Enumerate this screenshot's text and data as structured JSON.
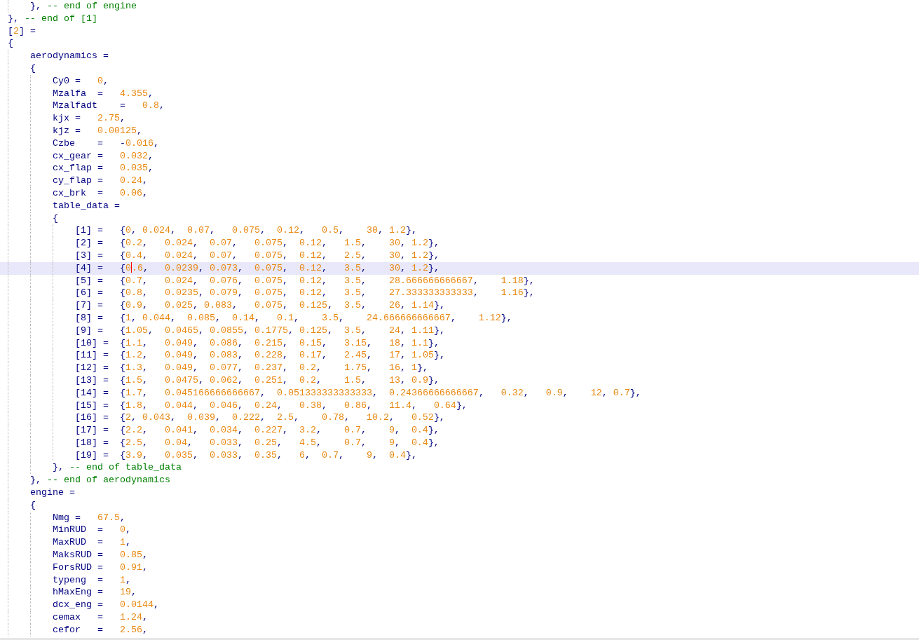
{
  "editor": {
    "lines": [
      {
        "current": false,
        "tokens": [
          {
            "kind": "code",
            "text": "\t}, "
          },
          {
            "kind": "comment",
            "text": "-- end of engine"
          }
        ]
      },
      {
        "current": false,
        "tokens": [
          {
            "kind": "code",
            "text": "}, "
          },
          {
            "kind": "comment",
            "text": "-- end of [1]"
          }
        ]
      },
      {
        "current": false,
        "tokens": [
          {
            "kind": "code",
            "text": "["
          },
          {
            "kind": "num",
            "text": "2"
          },
          {
            "kind": "code",
            "text": "] ="
          }
        ]
      },
      {
        "current": false,
        "tokens": [
          {
            "kind": "code",
            "text": "{"
          }
        ]
      },
      {
        "current": false,
        "tokens": [
          {
            "kind": "code",
            "text": "\taerodynamics ="
          }
        ]
      },
      {
        "current": false,
        "tokens": [
          {
            "kind": "code",
            "text": "\t{"
          }
        ]
      },
      {
        "current": false,
        "tokens": [
          {
            "kind": "code",
            "text": "\t\tCy0 =\t"
          },
          {
            "kind": "num",
            "text": "0"
          },
          {
            "kind": "code",
            "text": ","
          }
        ]
      },
      {
        "current": false,
        "tokens": [
          {
            "kind": "code",
            "text": "\t\tMzalfa\t=\t"
          },
          {
            "kind": "num",
            "text": "4.355"
          },
          {
            "kind": "code",
            "text": ","
          }
        ]
      },
      {
        "current": false,
        "tokens": [
          {
            "kind": "code",
            "text": "\t\tMzalfadt\t=\t"
          },
          {
            "kind": "num",
            "text": "0.8"
          },
          {
            "kind": "code",
            "text": ","
          }
        ]
      },
      {
        "current": false,
        "tokens": [
          {
            "kind": "code",
            "text": "\t\tkjx =\t"
          },
          {
            "kind": "num",
            "text": "2.75"
          },
          {
            "kind": "code",
            "text": ","
          }
        ]
      },
      {
        "current": false,
        "tokens": [
          {
            "kind": "code",
            "text": "\t\tkjz =\t"
          },
          {
            "kind": "num",
            "text": "0.00125"
          },
          {
            "kind": "code",
            "text": ","
          }
        ]
      },
      {
        "current": false,
        "tokens": [
          {
            "kind": "code",
            "text": "\t\tCzbe\t=\t-"
          },
          {
            "kind": "num",
            "text": "0.016"
          },
          {
            "kind": "code",
            "text": ","
          }
        ]
      },
      {
        "current": false,
        "tokens": [
          {
            "kind": "code",
            "text": "\t\tcx_gear =\t"
          },
          {
            "kind": "num",
            "text": "0.032"
          },
          {
            "kind": "code",
            "text": ","
          }
        ]
      },
      {
        "current": false,
        "tokens": [
          {
            "kind": "code",
            "text": "\t\tcx_flap =\t"
          },
          {
            "kind": "num",
            "text": "0.035"
          },
          {
            "kind": "code",
            "text": ","
          }
        ]
      },
      {
        "current": false,
        "tokens": [
          {
            "kind": "code",
            "text": "\t\tcy_flap =\t"
          },
          {
            "kind": "num",
            "text": "0.24"
          },
          {
            "kind": "code",
            "text": ","
          }
        ]
      },
      {
        "current": false,
        "tokens": [
          {
            "kind": "code",
            "text": "\t\tcx_brk\t=\t"
          },
          {
            "kind": "num",
            "text": "0.06"
          },
          {
            "kind": "code",
            "text": ","
          }
        ]
      },
      {
        "current": false,
        "tokens": [
          {
            "kind": "code",
            "text": "\t\ttable_data ="
          }
        ]
      },
      {
        "current": false,
        "tokens": [
          {
            "kind": "code",
            "text": "\t\t{"
          }
        ]
      },
      {
        "current": false,
        "tokens": [
          {
            "kind": "code",
            "text": "\t\t\t[1] =\t{"
          },
          {
            "kind": "num",
            "text": "0"
          },
          {
            "kind": "code",
            "text": ", "
          },
          {
            "kind": "num",
            "text": "0.024"
          },
          {
            "kind": "code",
            "text": ",\t"
          },
          {
            "kind": "num",
            "text": "0.07"
          },
          {
            "kind": "code",
            "text": ",\t"
          },
          {
            "kind": "num",
            "text": "0.075"
          },
          {
            "kind": "code",
            "text": ",\t"
          },
          {
            "kind": "num",
            "text": "0.12"
          },
          {
            "kind": "code",
            "text": ",\t"
          },
          {
            "kind": "num",
            "text": "0.5"
          },
          {
            "kind": "code",
            "text": ",\t"
          },
          {
            "kind": "num",
            "text": "30"
          },
          {
            "kind": "code",
            "text": ", "
          },
          {
            "kind": "num",
            "text": "1.2"
          },
          {
            "kind": "code",
            "text": "},"
          }
        ]
      },
      {
        "current": false,
        "tokens": [
          {
            "kind": "code",
            "text": "\t\t\t[2] =\t{"
          },
          {
            "kind": "num",
            "text": "0.2"
          },
          {
            "kind": "code",
            "text": ",\t"
          },
          {
            "kind": "num",
            "text": "0.024"
          },
          {
            "kind": "code",
            "text": ",\t"
          },
          {
            "kind": "num",
            "text": "0.07"
          },
          {
            "kind": "code",
            "text": ",\t"
          },
          {
            "kind": "num",
            "text": "0.075"
          },
          {
            "kind": "code",
            "text": ",\t"
          },
          {
            "kind": "num",
            "text": "0.12"
          },
          {
            "kind": "code",
            "text": ",\t"
          },
          {
            "kind": "num",
            "text": "1.5"
          },
          {
            "kind": "code",
            "text": ",\t"
          },
          {
            "kind": "num",
            "text": "30"
          },
          {
            "kind": "code",
            "text": ", "
          },
          {
            "kind": "num",
            "text": "1.2"
          },
          {
            "kind": "code",
            "text": "},"
          }
        ]
      },
      {
        "current": false,
        "tokens": [
          {
            "kind": "code",
            "text": "\t\t\t[3] =\t{"
          },
          {
            "kind": "num",
            "text": "0.4"
          },
          {
            "kind": "code",
            "text": ",\t"
          },
          {
            "kind": "num",
            "text": "0.024"
          },
          {
            "kind": "code",
            "text": ",\t"
          },
          {
            "kind": "num",
            "text": "0.07"
          },
          {
            "kind": "code",
            "text": ",\t"
          },
          {
            "kind": "num",
            "text": "0.075"
          },
          {
            "kind": "code",
            "text": ",\t"
          },
          {
            "kind": "num",
            "text": "0.12"
          },
          {
            "kind": "code",
            "text": ",\t"
          },
          {
            "kind": "num",
            "text": "2.5"
          },
          {
            "kind": "code",
            "text": ",\t"
          },
          {
            "kind": "num",
            "text": "30"
          },
          {
            "kind": "code",
            "text": ", "
          },
          {
            "kind": "num",
            "text": "1.2"
          },
          {
            "kind": "code",
            "text": "},"
          }
        ]
      },
      {
        "current": true,
        "tokens": [
          {
            "kind": "code",
            "text": "\t\t\t[4] =\t{"
          },
          {
            "kind": "num",
            "text": "0"
          },
          {
            "kind": "caret"
          },
          {
            "kind": "num",
            "text": ".6"
          },
          {
            "kind": "code",
            "text": ",\t"
          },
          {
            "kind": "num",
            "text": "0.0239"
          },
          {
            "kind": "code",
            "text": ", "
          },
          {
            "kind": "num",
            "text": "0.073"
          },
          {
            "kind": "code",
            "text": ",\t"
          },
          {
            "kind": "num",
            "text": "0.075"
          },
          {
            "kind": "code",
            "text": ",\t"
          },
          {
            "kind": "num",
            "text": "0.12"
          },
          {
            "kind": "code",
            "text": ",\t"
          },
          {
            "kind": "num",
            "text": "3.5"
          },
          {
            "kind": "code",
            "text": ",\t"
          },
          {
            "kind": "num",
            "text": "30"
          },
          {
            "kind": "code",
            "text": ", "
          },
          {
            "kind": "num",
            "text": "1.2"
          },
          {
            "kind": "code",
            "text": "},"
          }
        ]
      },
      {
        "current": false,
        "tokens": [
          {
            "kind": "code",
            "text": "\t\t\t[5] =\t{"
          },
          {
            "kind": "num",
            "text": "0.7"
          },
          {
            "kind": "code",
            "text": ",\t"
          },
          {
            "kind": "num",
            "text": "0.024"
          },
          {
            "kind": "code",
            "text": ",\t"
          },
          {
            "kind": "num",
            "text": "0.076"
          },
          {
            "kind": "code",
            "text": ",\t"
          },
          {
            "kind": "num",
            "text": "0.075"
          },
          {
            "kind": "code",
            "text": ",\t"
          },
          {
            "kind": "num",
            "text": "0.12"
          },
          {
            "kind": "code",
            "text": ",\t"
          },
          {
            "kind": "num",
            "text": "3.5"
          },
          {
            "kind": "code",
            "text": ",\t"
          },
          {
            "kind": "num",
            "text": "28.666666666667"
          },
          {
            "kind": "code",
            "text": ",\t"
          },
          {
            "kind": "num",
            "text": "1.18"
          },
          {
            "kind": "code",
            "text": "},"
          }
        ]
      },
      {
        "current": false,
        "tokens": [
          {
            "kind": "code",
            "text": "\t\t\t[6] =\t{"
          },
          {
            "kind": "num",
            "text": "0.8"
          },
          {
            "kind": "code",
            "text": ",\t"
          },
          {
            "kind": "num",
            "text": "0.0235"
          },
          {
            "kind": "code",
            "text": ", "
          },
          {
            "kind": "num",
            "text": "0.079"
          },
          {
            "kind": "code",
            "text": ",\t"
          },
          {
            "kind": "num",
            "text": "0.075"
          },
          {
            "kind": "code",
            "text": ",\t"
          },
          {
            "kind": "num",
            "text": "0.12"
          },
          {
            "kind": "code",
            "text": ",\t"
          },
          {
            "kind": "num",
            "text": "3.5"
          },
          {
            "kind": "code",
            "text": ",\t"
          },
          {
            "kind": "num",
            "text": "27.333333333333"
          },
          {
            "kind": "code",
            "text": ",\t"
          },
          {
            "kind": "num",
            "text": "1.16"
          },
          {
            "kind": "code",
            "text": "},"
          }
        ]
      },
      {
        "current": false,
        "tokens": [
          {
            "kind": "code",
            "text": "\t\t\t[7] =\t{"
          },
          {
            "kind": "num",
            "text": "0.9"
          },
          {
            "kind": "code",
            "text": ",\t"
          },
          {
            "kind": "num",
            "text": "0.025"
          },
          {
            "kind": "code",
            "text": ", "
          },
          {
            "kind": "num",
            "text": "0.083"
          },
          {
            "kind": "code",
            "text": ",\t"
          },
          {
            "kind": "num",
            "text": "0.075"
          },
          {
            "kind": "code",
            "text": ",\t"
          },
          {
            "kind": "num",
            "text": "0.125"
          },
          {
            "kind": "code",
            "text": ",\t"
          },
          {
            "kind": "num",
            "text": "3.5"
          },
          {
            "kind": "code",
            "text": ",\t"
          },
          {
            "kind": "num",
            "text": "26"
          },
          {
            "kind": "code",
            "text": ", "
          },
          {
            "kind": "num",
            "text": "1.14"
          },
          {
            "kind": "code",
            "text": "},"
          }
        ]
      },
      {
        "current": false,
        "tokens": [
          {
            "kind": "code",
            "text": "\t\t\t[8] =\t{"
          },
          {
            "kind": "num",
            "text": "1"
          },
          {
            "kind": "code",
            "text": ", "
          },
          {
            "kind": "num",
            "text": "0.044"
          },
          {
            "kind": "code",
            "text": ",\t"
          },
          {
            "kind": "num",
            "text": "0.085"
          },
          {
            "kind": "code",
            "text": ",\t"
          },
          {
            "kind": "num",
            "text": "0.14"
          },
          {
            "kind": "code",
            "text": ",\t"
          },
          {
            "kind": "num",
            "text": "0.1"
          },
          {
            "kind": "code",
            "text": ",\t"
          },
          {
            "kind": "num",
            "text": "3.5"
          },
          {
            "kind": "code",
            "text": ",\t"
          },
          {
            "kind": "num",
            "text": "24.666666666667"
          },
          {
            "kind": "code",
            "text": ",\t"
          },
          {
            "kind": "num",
            "text": "1.12"
          },
          {
            "kind": "code",
            "text": "},"
          }
        ]
      },
      {
        "current": false,
        "tokens": [
          {
            "kind": "code",
            "text": "\t\t\t[9] =\t{"
          },
          {
            "kind": "num",
            "text": "1.05"
          },
          {
            "kind": "code",
            "text": ",\t"
          },
          {
            "kind": "num",
            "text": "0.0465"
          },
          {
            "kind": "code",
            "text": ", "
          },
          {
            "kind": "num",
            "text": "0.0855"
          },
          {
            "kind": "code",
            "text": ", "
          },
          {
            "kind": "num",
            "text": "0.1775"
          },
          {
            "kind": "code",
            "text": ", "
          },
          {
            "kind": "num",
            "text": "0.125"
          },
          {
            "kind": "code",
            "text": ",\t"
          },
          {
            "kind": "num",
            "text": "3.5"
          },
          {
            "kind": "code",
            "text": ",\t"
          },
          {
            "kind": "num",
            "text": "24"
          },
          {
            "kind": "code",
            "text": ", "
          },
          {
            "kind": "num",
            "text": "1.11"
          },
          {
            "kind": "code",
            "text": "},"
          }
        ]
      },
      {
        "current": false,
        "tokens": [
          {
            "kind": "code",
            "text": "\t\t\t[10] =\t{"
          },
          {
            "kind": "num",
            "text": "1.1"
          },
          {
            "kind": "code",
            "text": ",\t"
          },
          {
            "kind": "num",
            "text": "0.049"
          },
          {
            "kind": "code",
            "text": ",\t"
          },
          {
            "kind": "num",
            "text": "0.086"
          },
          {
            "kind": "code",
            "text": ",\t"
          },
          {
            "kind": "num",
            "text": "0.215"
          },
          {
            "kind": "code",
            "text": ",\t"
          },
          {
            "kind": "num",
            "text": "0.15"
          },
          {
            "kind": "code",
            "text": ",\t"
          },
          {
            "kind": "num",
            "text": "3.15"
          },
          {
            "kind": "code",
            "text": ",\t"
          },
          {
            "kind": "num",
            "text": "18"
          },
          {
            "kind": "code",
            "text": ", "
          },
          {
            "kind": "num",
            "text": "1.1"
          },
          {
            "kind": "code",
            "text": "},"
          }
        ]
      },
      {
        "current": false,
        "tokens": [
          {
            "kind": "code",
            "text": "\t\t\t[11] =\t{"
          },
          {
            "kind": "num",
            "text": "1.2"
          },
          {
            "kind": "code",
            "text": ",\t"
          },
          {
            "kind": "num",
            "text": "0.049"
          },
          {
            "kind": "code",
            "text": ",\t"
          },
          {
            "kind": "num",
            "text": "0.083"
          },
          {
            "kind": "code",
            "text": ",\t"
          },
          {
            "kind": "num",
            "text": "0.228"
          },
          {
            "kind": "code",
            "text": ",\t"
          },
          {
            "kind": "num",
            "text": "0.17"
          },
          {
            "kind": "code",
            "text": ",\t"
          },
          {
            "kind": "num",
            "text": "2.45"
          },
          {
            "kind": "code",
            "text": ",\t"
          },
          {
            "kind": "num",
            "text": "17"
          },
          {
            "kind": "code",
            "text": ", "
          },
          {
            "kind": "num",
            "text": "1.05"
          },
          {
            "kind": "code",
            "text": "},"
          }
        ]
      },
      {
        "current": false,
        "tokens": [
          {
            "kind": "code",
            "text": "\t\t\t[12] =\t{"
          },
          {
            "kind": "num",
            "text": "1.3"
          },
          {
            "kind": "code",
            "text": ",\t"
          },
          {
            "kind": "num",
            "text": "0.049"
          },
          {
            "kind": "code",
            "text": ",\t"
          },
          {
            "kind": "num",
            "text": "0.077"
          },
          {
            "kind": "code",
            "text": ",\t"
          },
          {
            "kind": "num",
            "text": "0.237"
          },
          {
            "kind": "code",
            "text": ",\t"
          },
          {
            "kind": "num",
            "text": "0.2"
          },
          {
            "kind": "code",
            "text": ",\t"
          },
          {
            "kind": "num",
            "text": "1.75"
          },
          {
            "kind": "code",
            "text": ",\t"
          },
          {
            "kind": "num",
            "text": "16"
          },
          {
            "kind": "code",
            "text": ", "
          },
          {
            "kind": "num",
            "text": "1"
          },
          {
            "kind": "code",
            "text": "},"
          }
        ]
      },
      {
        "current": false,
        "tokens": [
          {
            "kind": "code",
            "text": "\t\t\t[13] =\t{"
          },
          {
            "kind": "num",
            "text": "1.5"
          },
          {
            "kind": "code",
            "text": ",\t"
          },
          {
            "kind": "num",
            "text": "0.0475"
          },
          {
            "kind": "code",
            "text": ", "
          },
          {
            "kind": "num",
            "text": "0.062"
          },
          {
            "kind": "code",
            "text": ",\t"
          },
          {
            "kind": "num",
            "text": "0.251"
          },
          {
            "kind": "code",
            "text": ",\t"
          },
          {
            "kind": "num",
            "text": "0.2"
          },
          {
            "kind": "code",
            "text": ",\t"
          },
          {
            "kind": "num",
            "text": "1.5"
          },
          {
            "kind": "code",
            "text": ",\t"
          },
          {
            "kind": "num",
            "text": "13"
          },
          {
            "kind": "code",
            "text": ", "
          },
          {
            "kind": "num",
            "text": "0.9"
          },
          {
            "kind": "code",
            "text": "},"
          }
        ]
      },
      {
        "current": false,
        "tokens": [
          {
            "kind": "code",
            "text": "\t\t\t[14] =\t{"
          },
          {
            "kind": "num",
            "text": "1.7"
          },
          {
            "kind": "code",
            "text": ",\t"
          },
          {
            "kind": "num",
            "text": "0.045166666666667"
          },
          {
            "kind": "code",
            "text": ",\t"
          },
          {
            "kind": "num",
            "text": "0.051333333333333"
          },
          {
            "kind": "code",
            "text": ",\t"
          },
          {
            "kind": "num",
            "text": "0.24366666666667"
          },
          {
            "kind": "code",
            "text": ",\t"
          },
          {
            "kind": "num",
            "text": "0.32"
          },
          {
            "kind": "code",
            "text": ",\t"
          },
          {
            "kind": "num",
            "text": "0.9"
          },
          {
            "kind": "code",
            "text": ",\t"
          },
          {
            "kind": "num",
            "text": "12"
          },
          {
            "kind": "code",
            "text": ", "
          },
          {
            "kind": "num",
            "text": "0.7"
          },
          {
            "kind": "code",
            "text": "},"
          }
        ]
      },
      {
        "current": false,
        "tokens": [
          {
            "kind": "code",
            "text": "\t\t\t[15] =\t{"
          },
          {
            "kind": "num",
            "text": "1.8"
          },
          {
            "kind": "code",
            "text": ",\t"
          },
          {
            "kind": "num",
            "text": "0.044"
          },
          {
            "kind": "code",
            "text": ",\t"
          },
          {
            "kind": "num",
            "text": "0.046"
          },
          {
            "kind": "code",
            "text": ",\t"
          },
          {
            "kind": "num",
            "text": "0.24"
          },
          {
            "kind": "code",
            "text": ",\t"
          },
          {
            "kind": "num",
            "text": "0.38"
          },
          {
            "kind": "code",
            "text": ",\t"
          },
          {
            "kind": "num",
            "text": "0.86"
          },
          {
            "kind": "code",
            "text": ",\t"
          },
          {
            "kind": "num",
            "text": "11.4"
          },
          {
            "kind": "code",
            "text": ",\t"
          },
          {
            "kind": "num",
            "text": "0.64"
          },
          {
            "kind": "code",
            "text": "},"
          }
        ]
      },
      {
        "current": false,
        "tokens": [
          {
            "kind": "code",
            "text": "\t\t\t[16] =\t{"
          },
          {
            "kind": "num",
            "text": "2"
          },
          {
            "kind": "code",
            "text": ", "
          },
          {
            "kind": "num",
            "text": "0.043"
          },
          {
            "kind": "code",
            "text": ",\t"
          },
          {
            "kind": "num",
            "text": "0.039"
          },
          {
            "kind": "code",
            "text": ",\t"
          },
          {
            "kind": "num",
            "text": "0.222"
          },
          {
            "kind": "code",
            "text": ",\t"
          },
          {
            "kind": "num",
            "text": "2.5"
          },
          {
            "kind": "code",
            "text": ",\t"
          },
          {
            "kind": "num",
            "text": "0.78"
          },
          {
            "kind": "code",
            "text": ",\t"
          },
          {
            "kind": "num",
            "text": "10.2"
          },
          {
            "kind": "code",
            "text": ",\t"
          },
          {
            "kind": "num",
            "text": "0.52"
          },
          {
            "kind": "code",
            "text": "},"
          }
        ]
      },
      {
        "current": false,
        "tokens": [
          {
            "kind": "code",
            "text": "\t\t\t[17] =\t{"
          },
          {
            "kind": "num",
            "text": "2.2"
          },
          {
            "kind": "code",
            "text": ",\t"
          },
          {
            "kind": "num",
            "text": "0.041"
          },
          {
            "kind": "code",
            "text": ",\t"
          },
          {
            "kind": "num",
            "text": "0.034"
          },
          {
            "kind": "code",
            "text": ",\t"
          },
          {
            "kind": "num",
            "text": "0.227"
          },
          {
            "kind": "code",
            "text": ",\t"
          },
          {
            "kind": "num",
            "text": "3.2"
          },
          {
            "kind": "code",
            "text": ",\t"
          },
          {
            "kind": "num",
            "text": "0.7"
          },
          {
            "kind": "code",
            "text": ",\t"
          },
          {
            "kind": "num",
            "text": "9"
          },
          {
            "kind": "code",
            "text": ",\t"
          },
          {
            "kind": "num",
            "text": "0.4"
          },
          {
            "kind": "code",
            "text": "},"
          }
        ]
      },
      {
        "current": false,
        "tokens": [
          {
            "kind": "code",
            "text": "\t\t\t[18] =\t{"
          },
          {
            "kind": "num",
            "text": "2.5"
          },
          {
            "kind": "code",
            "text": ",\t"
          },
          {
            "kind": "num",
            "text": "0.04"
          },
          {
            "kind": "code",
            "text": ",\t"
          },
          {
            "kind": "num",
            "text": "0.033"
          },
          {
            "kind": "code",
            "text": ",\t"
          },
          {
            "kind": "num",
            "text": "0.25"
          },
          {
            "kind": "code",
            "text": ",\t"
          },
          {
            "kind": "num",
            "text": "4.5"
          },
          {
            "kind": "code",
            "text": ",\t"
          },
          {
            "kind": "num",
            "text": "0.7"
          },
          {
            "kind": "code",
            "text": ",\t"
          },
          {
            "kind": "num",
            "text": "9"
          },
          {
            "kind": "code",
            "text": ",\t"
          },
          {
            "kind": "num",
            "text": "0.4"
          },
          {
            "kind": "code",
            "text": "},"
          }
        ]
      },
      {
        "current": false,
        "tokens": [
          {
            "kind": "code",
            "text": "\t\t\t[19] =\t{"
          },
          {
            "kind": "num",
            "text": "3.9"
          },
          {
            "kind": "code",
            "text": ",\t"
          },
          {
            "kind": "num",
            "text": "0.035"
          },
          {
            "kind": "code",
            "text": ",\t"
          },
          {
            "kind": "num",
            "text": "0.033"
          },
          {
            "kind": "code",
            "text": ",\t"
          },
          {
            "kind": "num",
            "text": "0.35"
          },
          {
            "kind": "code",
            "text": ",\t"
          },
          {
            "kind": "num",
            "text": "6"
          },
          {
            "kind": "code",
            "text": ",\t"
          },
          {
            "kind": "num",
            "text": "0.7"
          },
          {
            "kind": "code",
            "text": ",\t"
          },
          {
            "kind": "num",
            "text": "9"
          },
          {
            "kind": "code",
            "text": ",\t"
          },
          {
            "kind": "num",
            "text": "0.4"
          },
          {
            "kind": "code",
            "text": "},"
          }
        ]
      },
      {
        "current": false,
        "tokens": [
          {
            "kind": "code",
            "text": "\t\t}, "
          },
          {
            "kind": "comment",
            "text": "-- end of table_data"
          }
        ]
      },
      {
        "current": false,
        "tokens": [
          {
            "kind": "code",
            "text": "\t}, "
          },
          {
            "kind": "comment",
            "text": "-- end of aerodynamics"
          }
        ]
      },
      {
        "current": false,
        "tokens": [
          {
            "kind": "code",
            "text": "\tengine ="
          }
        ]
      },
      {
        "current": false,
        "tokens": [
          {
            "kind": "code",
            "text": "\t{"
          }
        ]
      },
      {
        "current": false,
        "tokens": [
          {
            "kind": "code",
            "text": "\t\tNmg =\t"
          },
          {
            "kind": "num",
            "text": "67.5"
          },
          {
            "kind": "code",
            "text": ","
          }
        ]
      },
      {
        "current": false,
        "tokens": [
          {
            "kind": "code",
            "text": "\t\tMinRUD\t=\t"
          },
          {
            "kind": "num",
            "text": "0"
          },
          {
            "kind": "code",
            "text": ","
          }
        ]
      },
      {
        "current": false,
        "tokens": [
          {
            "kind": "code",
            "text": "\t\tMaxRUD\t=\t"
          },
          {
            "kind": "num",
            "text": "1"
          },
          {
            "kind": "code",
            "text": ","
          }
        ]
      },
      {
        "current": false,
        "tokens": [
          {
            "kind": "code",
            "text": "\t\tMaksRUD =\t"
          },
          {
            "kind": "num",
            "text": "0.85"
          },
          {
            "kind": "code",
            "text": ","
          }
        ]
      },
      {
        "current": false,
        "tokens": [
          {
            "kind": "code",
            "text": "\t\tForsRUD =\t"
          },
          {
            "kind": "num",
            "text": "0.91"
          },
          {
            "kind": "code",
            "text": ","
          }
        ]
      },
      {
        "current": false,
        "tokens": [
          {
            "kind": "code",
            "text": "\t\ttypeng\t=\t"
          },
          {
            "kind": "num",
            "text": "1"
          },
          {
            "kind": "code",
            "text": ","
          }
        ]
      },
      {
        "current": false,
        "tokens": [
          {
            "kind": "code",
            "text": "\t\thMaxEng =\t"
          },
          {
            "kind": "num",
            "text": "19"
          },
          {
            "kind": "code",
            "text": ","
          }
        ]
      },
      {
        "current": false,
        "tokens": [
          {
            "kind": "code",
            "text": "\t\tdcx_eng =\t"
          },
          {
            "kind": "num",
            "text": "0.0144"
          },
          {
            "kind": "code",
            "text": ","
          }
        ]
      },
      {
        "current": false,
        "tokens": [
          {
            "kind": "code",
            "text": "\t\tcemax\t=\t"
          },
          {
            "kind": "num",
            "text": "1.24"
          },
          {
            "kind": "code",
            "text": ","
          }
        ]
      },
      {
        "current": false,
        "tokens": [
          {
            "kind": "code",
            "text": "\t\tcefor\t=\t"
          },
          {
            "kind": "num",
            "text": "2.56"
          },
          {
            "kind": "code",
            "text": ","
          }
        ]
      }
    ]
  }
}
